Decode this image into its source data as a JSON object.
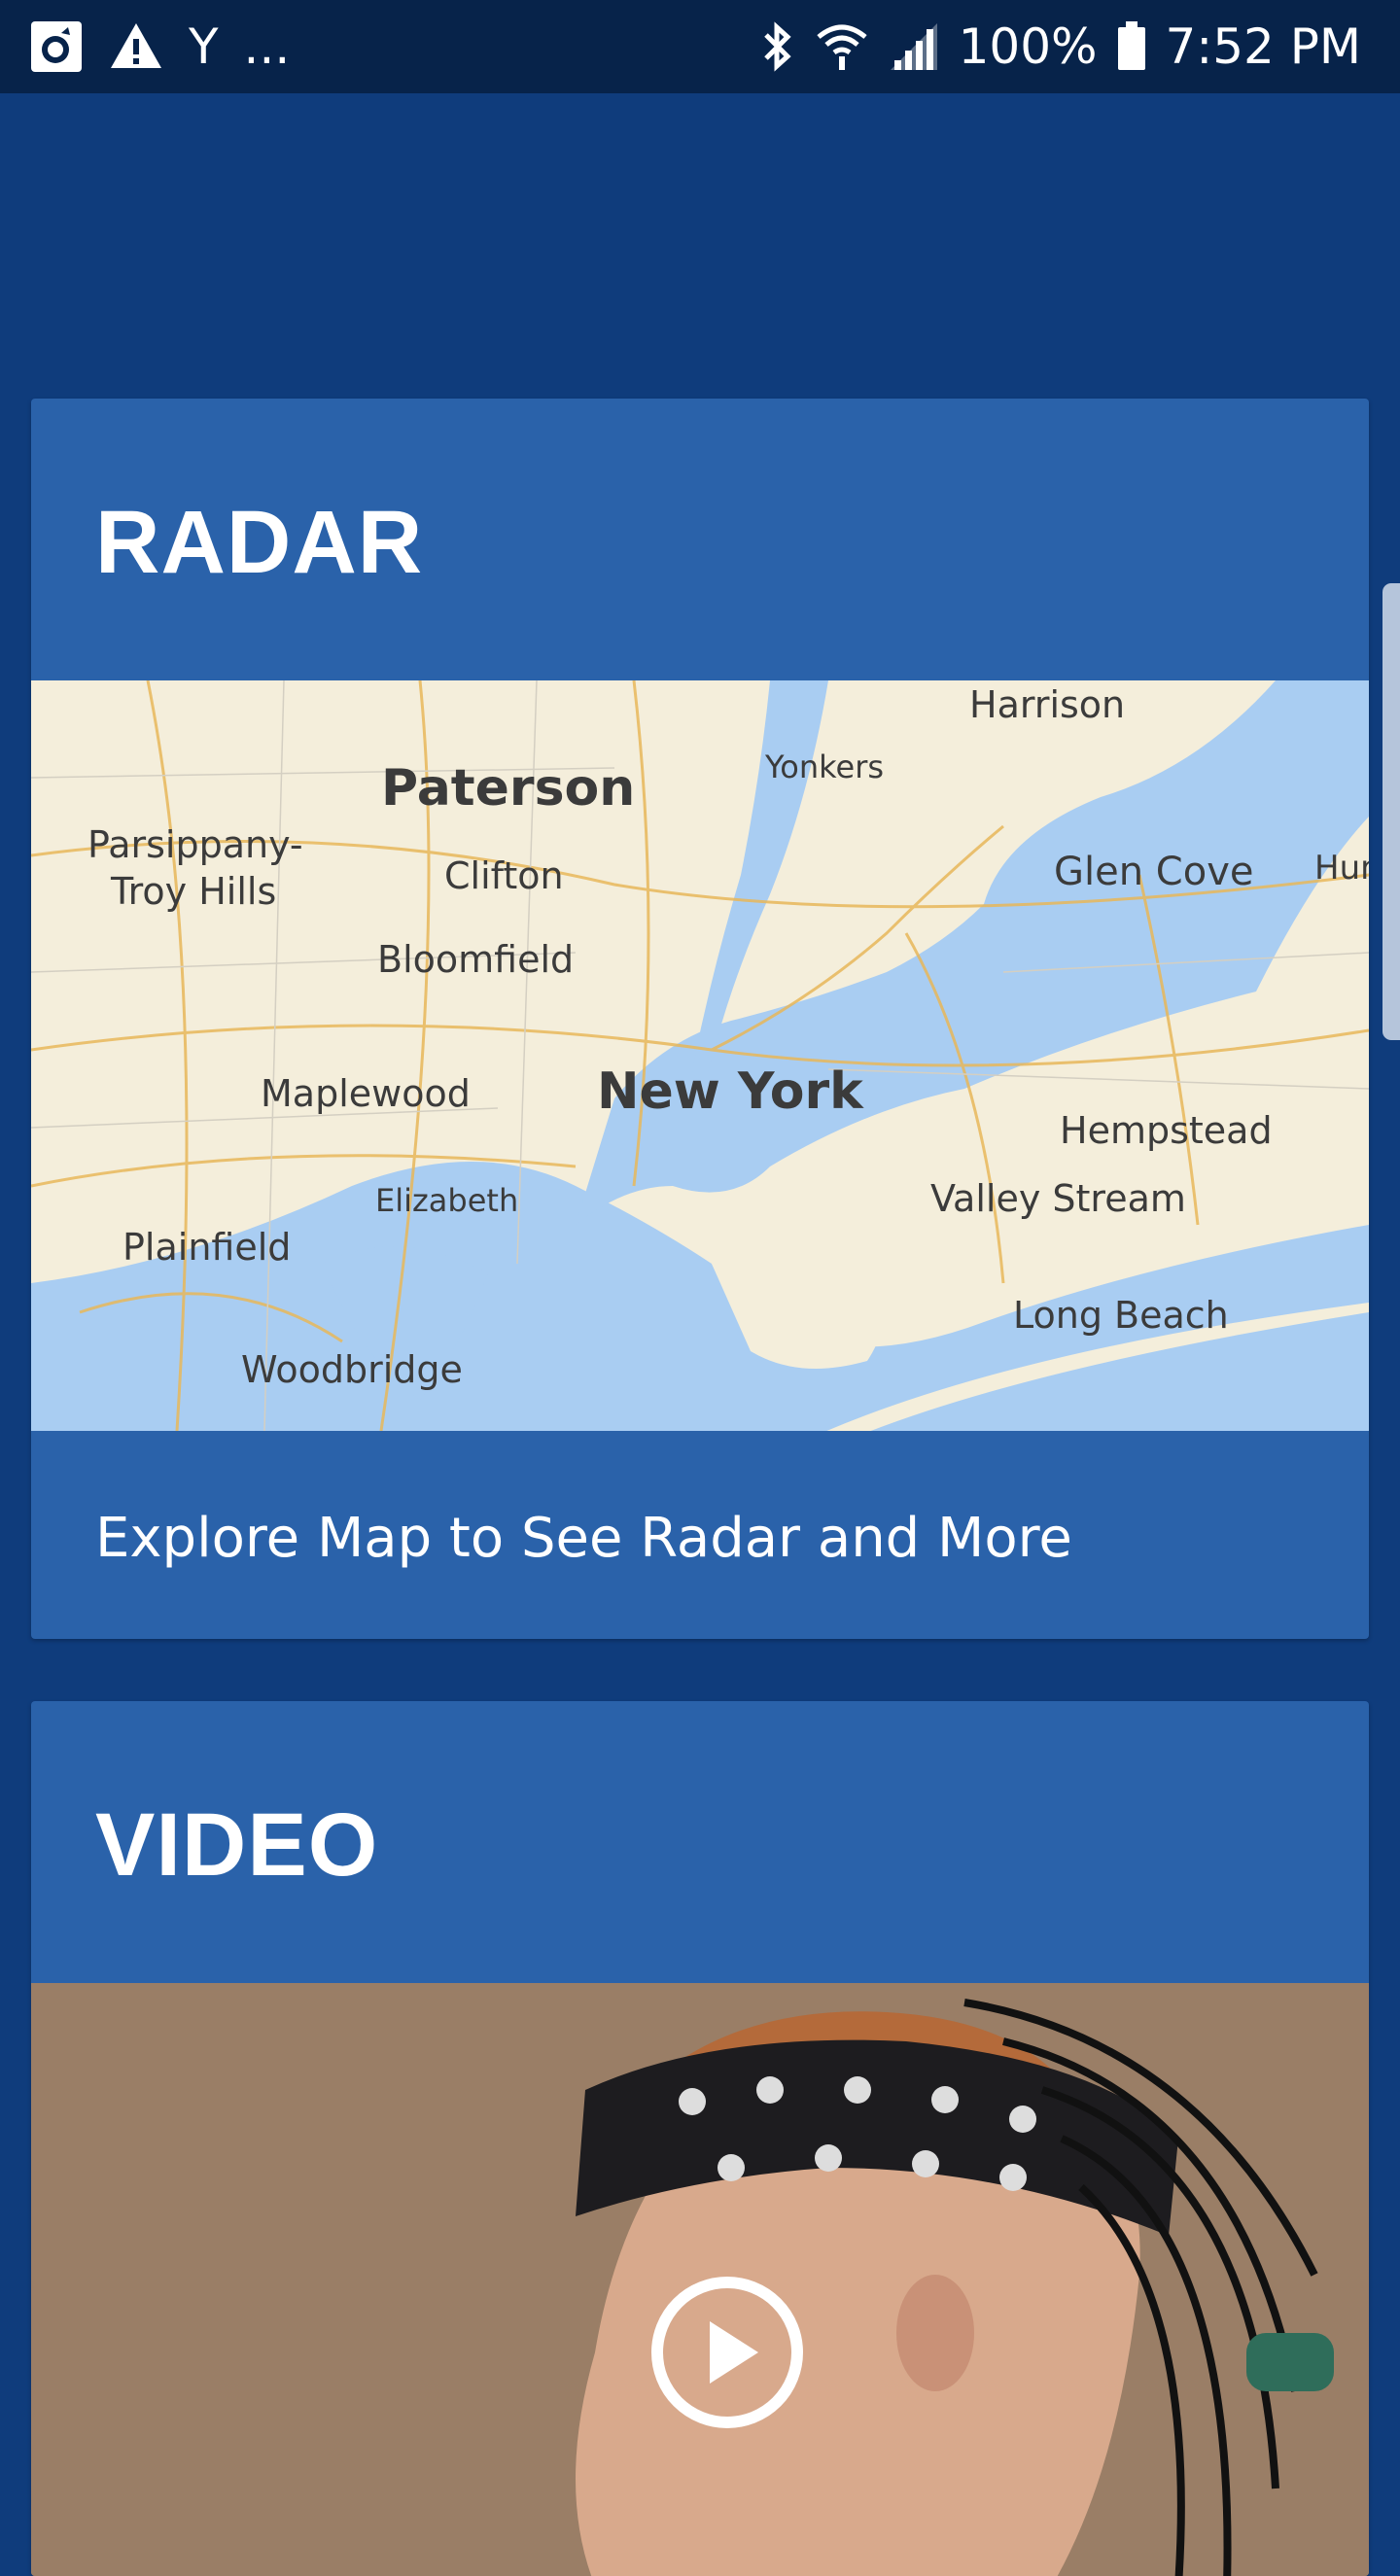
{
  "status_bar": {
    "left_icons": [
      "app-notification-icon",
      "warning-icon",
      "yahoo-icon"
    ],
    "yahoo_glyph": "Y",
    "more_indicator": "...",
    "right_icons": [
      "bluetooth-icon",
      "wifi-icon",
      "signal-icon",
      "battery-icon"
    ],
    "battery": "100%",
    "time": "7:52 PM"
  },
  "radar_card": {
    "title": "RADAR",
    "map_labels": {
      "harrison": "Harrison",
      "yonkers": "Yonkers",
      "paterson": "Paterson",
      "parsippany": "Parsippany-",
      "troy_hills": "Troy Hills",
      "clifton": "Clifton",
      "glen_cove": "Glen Cove",
      "hun": "Hun",
      "bloomfield": "Bloomfield",
      "maplewood": "Maplewood",
      "new_york": "New York",
      "hempstead": "Hempstead",
      "elizabeth": "Elizabeth",
      "valley_stream": "Valley Stream",
      "plainfield": "Plainfield",
      "long_beach": "Long Beach",
      "woodbridge": "Woodbridge"
    },
    "link_text": "Explore Map to See Radar and More"
  },
  "video_card": {
    "title": "VIDEO",
    "play_icon": "play-icon"
  },
  "colors": {
    "background": "#0f3c7c",
    "card": "#2a62aa",
    "status_bar": "#07234a"
  }
}
